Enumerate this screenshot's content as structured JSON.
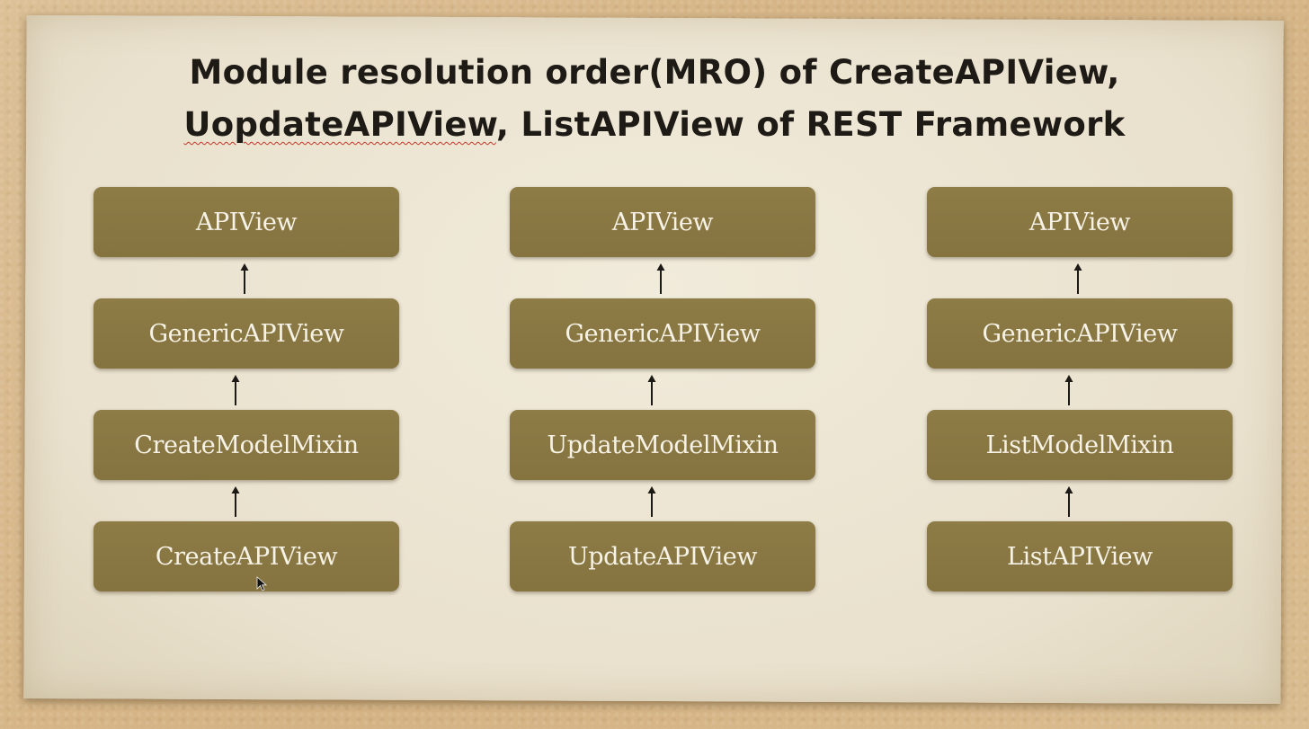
{
  "title": {
    "line1": "Module resolution order(MRO) of CreateAPIView,",
    "line2_word1": "UopdateAPIView",
    "line2_rest": ", ListAPIView of REST Framework"
  },
  "columns": [
    {
      "boxes": [
        "APIView",
        "GenericAPIView",
        "CreateModelMixin",
        "CreateAPIView"
      ]
    },
    {
      "boxes": [
        "APIView",
        "GenericAPIView",
        "UpdateModelMixin",
        "UpdateAPIView"
      ]
    },
    {
      "boxes": [
        "APIView",
        "GenericAPIView",
        "ListModelMixin",
        "ListAPIView"
      ]
    }
  ],
  "icons": {
    "arrow": "arrow-up-icon",
    "cursor": "mouse-cursor-icon"
  },
  "colors": {
    "box_fill": "#8a7842",
    "box_text": "#f7f2e6",
    "paper": "#ede6d4",
    "background": "#d8bb8e",
    "title_text": "#1e1a15"
  }
}
